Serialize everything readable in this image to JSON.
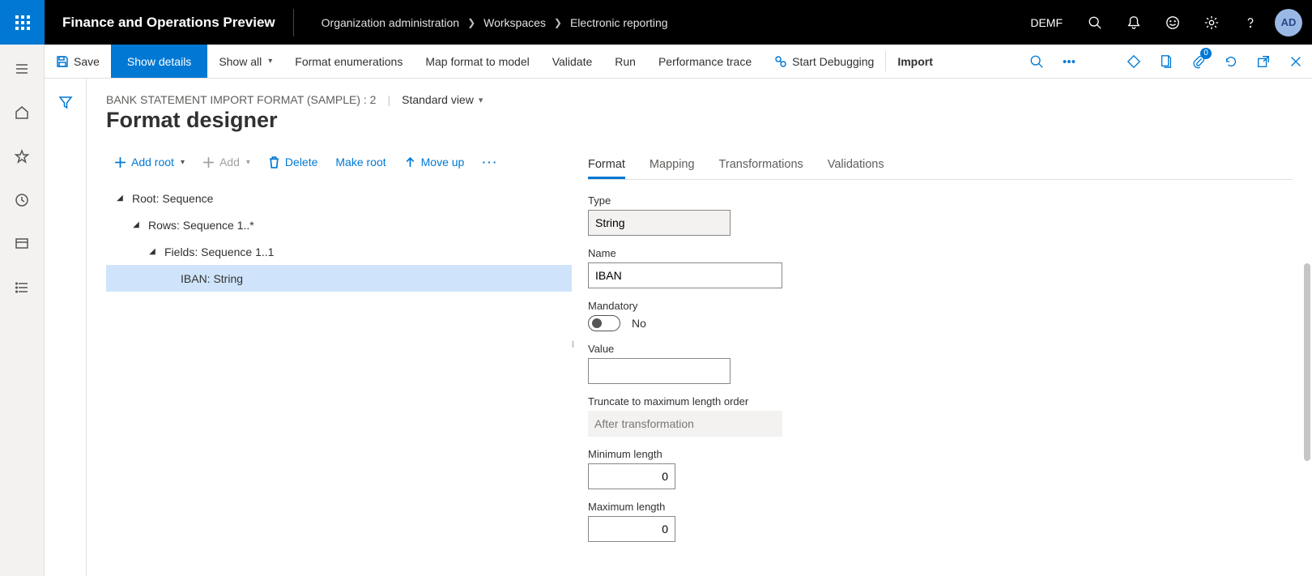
{
  "topbar": {
    "app_title": "Finance and Operations Preview",
    "breadcrumbs": [
      "Organization administration",
      "Workspaces",
      "Electronic reporting"
    ],
    "company": "DEMF",
    "avatar": "AD"
  },
  "cmdbar": {
    "save": "Save",
    "show_details": "Show details",
    "show_all": "Show all",
    "format_enum": "Format enumerations",
    "map_format": "Map format to model",
    "validate": "Validate",
    "run": "Run",
    "perf_trace": "Performance trace",
    "start_debug": "Start Debugging",
    "import": "Import",
    "badge": "0"
  },
  "header": {
    "context": "BANK STATEMENT IMPORT FORMAT (SAMPLE) : 2",
    "view_label": "Standard view",
    "page_title": "Format designer"
  },
  "treecmds": {
    "add_root": "Add root",
    "add": "Add",
    "delete": "Delete",
    "make_root": "Make root",
    "move_up": "Move up"
  },
  "tree": {
    "n0": "Root: Sequence",
    "n1": "Rows: Sequence 1..*",
    "n2": "Fields: Sequence 1..1",
    "n3": "IBAN: String"
  },
  "tabs": {
    "format": "Format",
    "mapping": "Mapping",
    "transformations": "Transformations",
    "validations": "Validations"
  },
  "form": {
    "type_label": "Type",
    "type_value": "String",
    "name_label": "Name",
    "name_value": "IBAN",
    "mandatory_label": "Mandatory",
    "mandatory_value": "No",
    "value_label": "Value",
    "value_value": "",
    "truncate_label": "Truncate to maximum length order",
    "truncate_value": "After transformation",
    "minlen_label": "Minimum length",
    "minlen_value": "0",
    "maxlen_label": "Maximum length",
    "maxlen_value": "0"
  }
}
